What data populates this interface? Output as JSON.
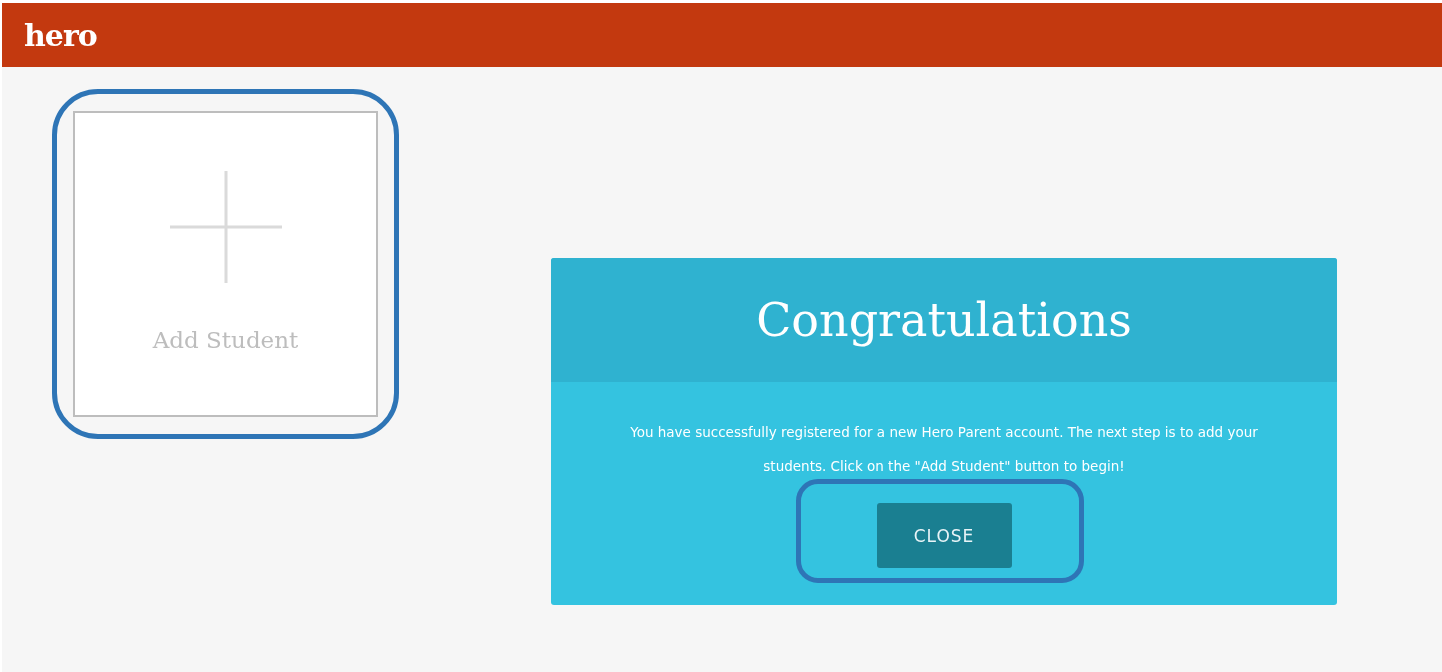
{
  "header": {
    "logo": "hero"
  },
  "add_card": {
    "label": "Add Student",
    "highlighted": true
  },
  "dialog": {
    "title": "Congratulations",
    "message": "You have successfully registered for a new Hero Parent account. The next step is to add your students. Click on the \"Add Student\" button to begin!",
    "button": {
      "label": "CLOSE",
      "highlighted": true
    }
  }
}
